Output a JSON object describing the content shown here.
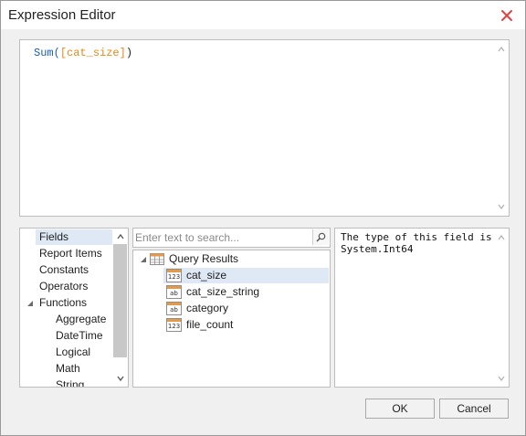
{
  "window": {
    "title": "Expression Editor"
  },
  "editor": {
    "function": "Sum(",
    "field": "[cat_size]",
    "close": ")"
  },
  "categories": [
    {
      "label": "Fields",
      "selected": true
    },
    {
      "label": "Report Items"
    },
    {
      "label": "Constants"
    },
    {
      "label": "Operators"
    },
    {
      "label": "Functions",
      "expanded": true
    },
    {
      "label": "Aggregate"
    },
    {
      "label": "DateTime"
    },
    {
      "label": "Logical"
    },
    {
      "label": "Math"
    },
    {
      "label": "String"
    }
  ],
  "search": {
    "placeholder": "Enter text to search..."
  },
  "tree": {
    "root": "Query Results",
    "fields": [
      {
        "label": "cat_size",
        "type": "123",
        "selected": true
      },
      {
        "label": "cat_size_string",
        "type": "ab"
      },
      {
        "label": "category",
        "type": "ab"
      },
      {
        "label": "file_count",
        "type": "123"
      }
    ]
  },
  "info": {
    "line1": "The type of this field is:",
    "line2": "System.Int64"
  },
  "buttons": {
    "ok": "OK",
    "cancel": "Cancel"
  },
  "colors": {
    "close_button": "#e04343",
    "selection": "#dfe9f5",
    "keyword": "#1a5fb4",
    "field": "#e08a19"
  }
}
